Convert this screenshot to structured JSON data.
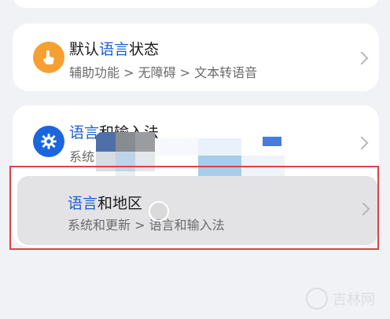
{
  "settings": {
    "item1": {
      "title_prefix": "默认",
      "title_highlight": "语言",
      "title_suffix": "状态",
      "subtitle": "辅助功能 > 无障碍 > 文本转语音"
    },
    "item2": {
      "title_highlight": "语言",
      "title_suffix": "和输入法",
      "subtitle": "系统"
    },
    "item3": {
      "title_highlight": "语言",
      "title_suffix": "和地区",
      "subtitle": "系统和更新 > 语言和输入法"
    }
  },
  "icons": {
    "item1": "accessibility-hand-icon",
    "item2": "gear-icon",
    "chevron": "chevron-right-icon",
    "watermark": "watermark-logo-icon"
  },
  "watermark": {
    "text": "吉林网"
  },
  "colors": {
    "highlight": "#1b5fd6",
    "orange_icon": "#f6a032",
    "blue_icon": "#1b66e0",
    "selection_outline": "#d8444a",
    "background": "#f1f2f5"
  }
}
